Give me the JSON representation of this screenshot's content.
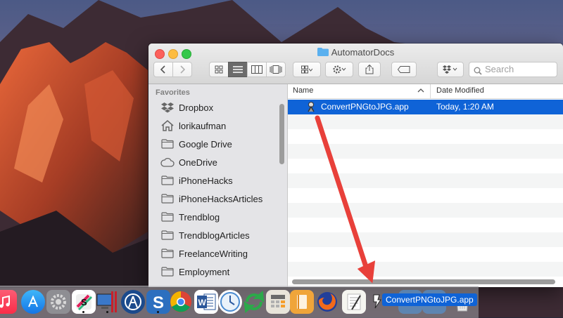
{
  "window": {
    "title": "AutomatorDocs",
    "search_placeholder": "Search"
  },
  "sidebar": {
    "header": "Favorites",
    "items": [
      {
        "label": "Dropbox",
        "icon": "dropbox-icon"
      },
      {
        "label": "lorikaufman",
        "icon": "home-icon"
      },
      {
        "label": "Google Drive",
        "icon": "folder-icon"
      },
      {
        "label": "OneDrive",
        "icon": "cloud-icon"
      },
      {
        "label": "iPhoneHacks",
        "icon": "folder-icon"
      },
      {
        "label": "iPhoneHacksArticles",
        "icon": "folder-icon"
      },
      {
        "label": "Trendblog",
        "icon": "folder-icon"
      },
      {
        "label": "TrendblogArticles",
        "icon": "folder-icon"
      },
      {
        "label": "FreelanceWriting",
        "icon": "folder-icon"
      },
      {
        "label": "Employment",
        "icon": "folder-icon"
      }
    ]
  },
  "list": {
    "columns": {
      "name": "Name",
      "date": "Date Modified"
    },
    "rows": [
      {
        "name": "ConvertPNGtoJPG.app",
        "date": "Today, 1:20 AM",
        "selected": true
      }
    ]
  },
  "drag": {
    "label": "ConvertPNGtoJPG.app"
  },
  "colors": {
    "selection": "#0f63d7",
    "arrow": "#e8403a"
  }
}
